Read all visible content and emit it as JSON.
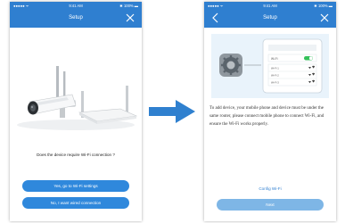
{
  "colors": {
    "accent": "#2f7fd0",
    "button": "#2f88dc",
    "next_button": "#7eb6e6",
    "diagram_bg": "#e9f3fb",
    "arrow": "#2f80cf"
  },
  "left_screen": {
    "status": {
      "signal": "●●●●● ᯤ",
      "time": "9:41 AM",
      "battery": "✱ 100% ▬"
    },
    "nav": {
      "title": "Setup",
      "close_icon": "close-icon"
    },
    "question": "Does the device require Wi-Fi connection ?",
    "buttons": {
      "yes": "Yes, go to Wi-Fi settings",
      "no": "No, I want wired connection"
    }
  },
  "right_screen": {
    "status": {
      "signal": "●●●●● ᯤ",
      "time": "9:41 AM",
      "battery": "✱ 100% ▬"
    },
    "nav": {
      "title": "Setup",
      "back_icon": "back-chevron-icon",
      "close_icon": "close-icon"
    },
    "diagram": {
      "settings_icon": "settings-gear-icon",
      "wifi_header": "Wi-Fi",
      "networks": [
        "Wi-Fi 1",
        "Wi-Fi 2",
        "Wi-Fi 3"
      ]
    },
    "instruction": "To add device, your mobile phone and device must be under the same router, please connect mobile phone to connect Wi-Fi, and ensure the Wi-Fi works properly.",
    "config_link": "Config Wi-Fi",
    "next_button": "Next"
  }
}
